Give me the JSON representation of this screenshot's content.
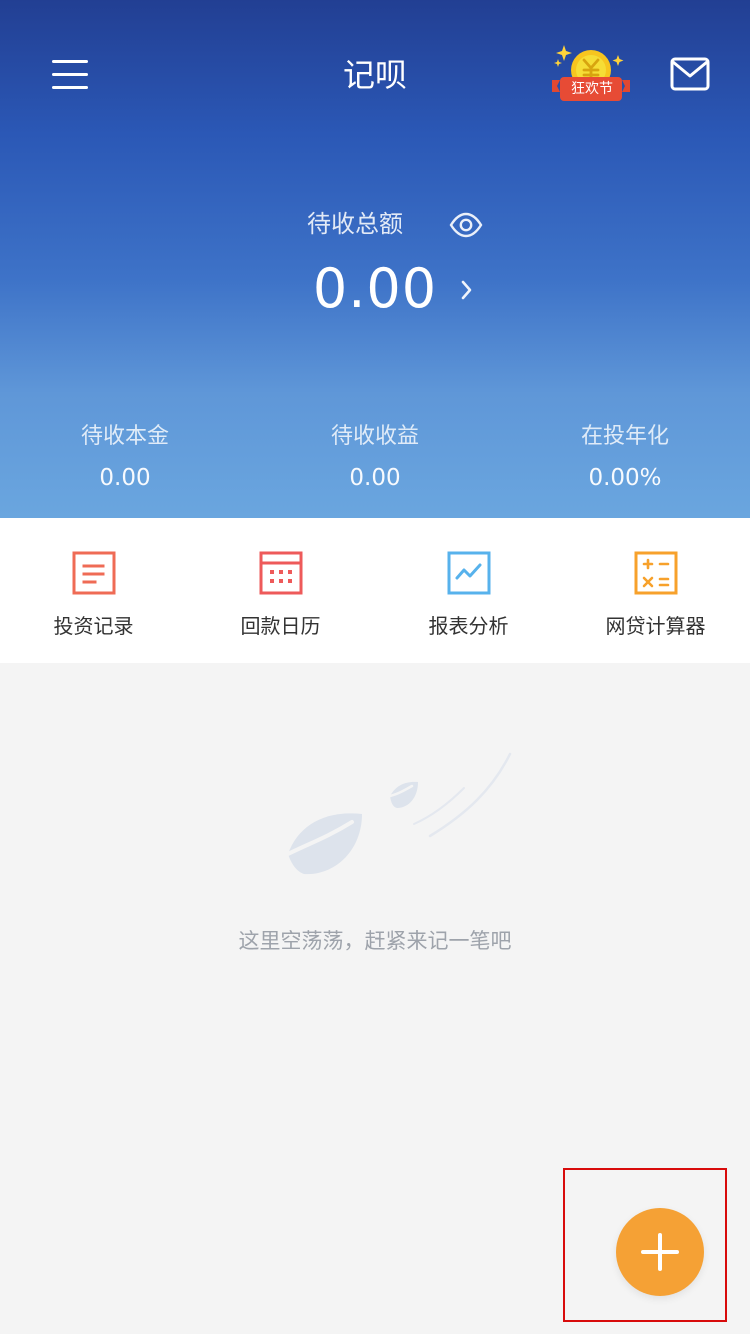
{
  "colors": {
    "hero_gradient_top": "#223f93",
    "hero_gradient_bottom": "#6aa6df",
    "page_background": "#f4f4f4",
    "quick_record": "#ef6b55",
    "quick_calendar": "#ee5a5a",
    "quick_report": "#57b2ec",
    "quick_calculator": "#f7a12b",
    "fab_background": "#f5a135",
    "empty_text": "#9ea3ab"
  },
  "header": {
    "menu_icon": "hamburger-menu-icon",
    "title": "记呗",
    "promo_badge": {
      "label": "狂欢节",
      "icon": "festival-coin-badge-icon"
    },
    "mail_icon": "mail-icon"
  },
  "summary": {
    "label": "待收总额",
    "visibility_icon": "eye-icon",
    "value": "0.00",
    "chevron_icon": "chevron-right-icon"
  },
  "metrics": [
    {
      "label": "待收本金",
      "value": "0.00"
    },
    {
      "label": "待收收益",
      "value": "0.00"
    },
    {
      "label": "在投年化",
      "value": "0.00%"
    }
  ],
  "quick_actions": [
    {
      "label": "投资记录",
      "icon": "record-document-icon"
    },
    {
      "label": "回款日历",
      "icon": "calendar-icon"
    },
    {
      "label": "报表分析",
      "icon": "report-chart-icon"
    },
    {
      "label": "网贷计算器",
      "icon": "calculator-icon"
    }
  ],
  "empty_state": {
    "illustration": "falling-leaves-illustration",
    "text": "这里空荡荡，赶紧来记一笔吧"
  },
  "fab": {
    "icon": "plus-icon"
  }
}
